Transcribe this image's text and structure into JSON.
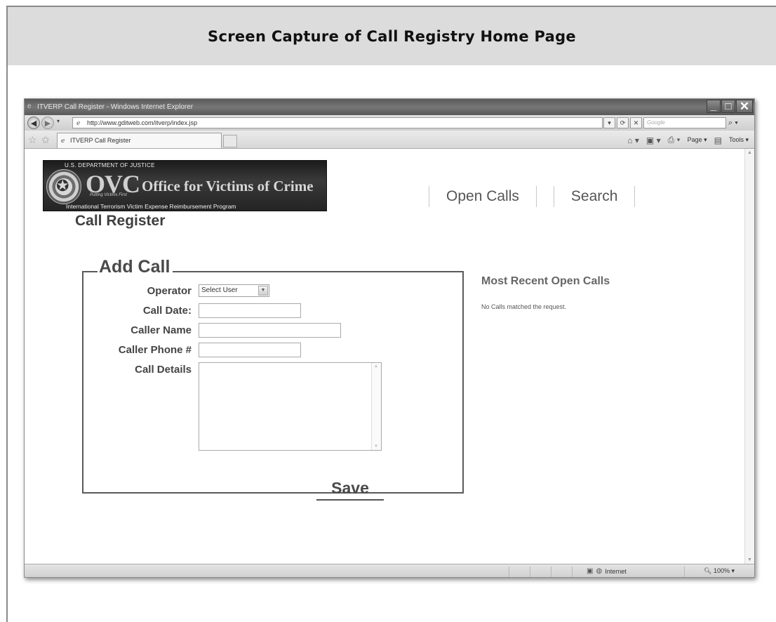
{
  "document": {
    "title": "Screen Capture of Call Registry Home Page"
  },
  "browser": {
    "window_title": "ITVERP Call Register - Windows Internet Explorer",
    "url": "http://www.gditweb.com/itverp/index.jsp",
    "search_placeholder": "Google",
    "tab_label": "ITVERP Call Register",
    "commands": {
      "page": "Page ▾",
      "tools": "Tools ▾"
    },
    "status": {
      "zone": "Internet",
      "zoom": "100%"
    }
  },
  "site": {
    "banner": {
      "department": "U.S. DEPARTMENT OF JUSTICE",
      "acronym": "OVC",
      "office_name": "Office for Victims of Crime",
      "tagline": "Putting Victims First",
      "program": "International Terrorism Victim Expense Reimbursement Program"
    },
    "heading": "Call Register",
    "nav": [
      "Open Calls",
      "Search"
    ]
  },
  "form": {
    "legend": "Add Call",
    "operator_label": "Operator",
    "operator_value": "Select User",
    "call_date_label": "Call Date:",
    "call_date_value": "",
    "caller_name_label": "Caller Name",
    "caller_name_value": "",
    "caller_phone_label": "Caller Phone #",
    "caller_phone_value": "",
    "call_details_label": "Call Details",
    "call_details_value": "",
    "save_label": "Save"
  },
  "recent": {
    "title": "Most Recent Open Calls",
    "empty_message": "No Calls matched the request."
  }
}
